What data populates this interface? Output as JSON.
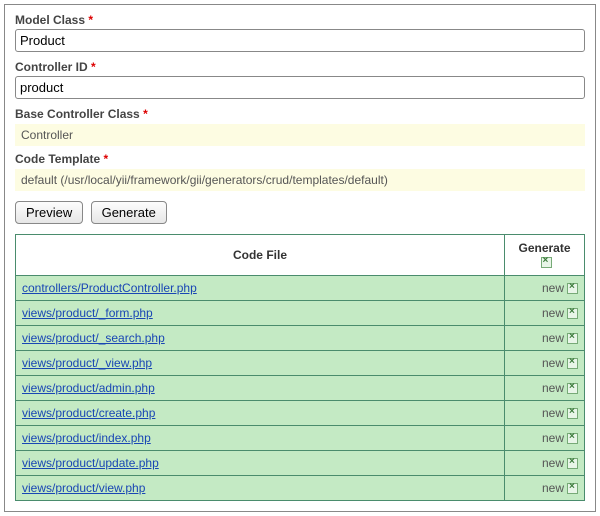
{
  "fields": {
    "modelClass": {
      "label": "Model Class",
      "value": "Product",
      "required": true
    },
    "controllerId": {
      "label": "Controller ID",
      "value": "product",
      "required": true
    },
    "baseController": {
      "label": "Base Controller Class",
      "value": "Controller",
      "required": true
    },
    "codeTemplate": {
      "label": "Code Template",
      "value": "default (/usr/local/yii/framework/gii/generators/crud/templates/default)",
      "required": true
    }
  },
  "buttons": {
    "preview": "Preview",
    "generate": "Generate"
  },
  "table": {
    "headers": {
      "codeFile": "Code File",
      "generate": "Generate"
    },
    "status_new": "new",
    "files": [
      "controllers/ProductController.php",
      "views/product/_form.php",
      "views/product/_search.php",
      "views/product/_view.php",
      "views/product/admin.php",
      "views/product/create.php",
      "views/product/index.php",
      "views/product/update.php",
      "views/product/view.php"
    ]
  }
}
